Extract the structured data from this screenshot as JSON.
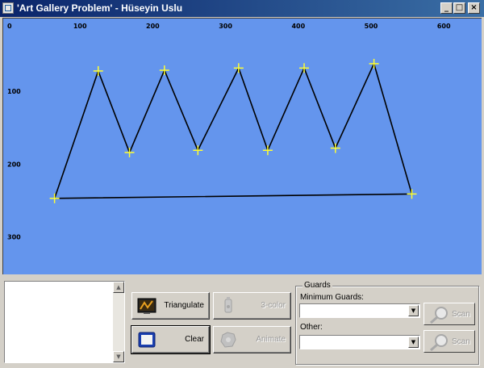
{
  "window": {
    "title": "'Art Gallery Problem' - Hüseyin Uslu",
    "controls": {
      "minimize": "_",
      "maximize": "□",
      "close": "×"
    }
  },
  "canvas": {
    "background": "#6495ed",
    "x_ticks": [
      "0",
      "100",
      "200",
      "300",
      "400",
      "500",
      "600"
    ],
    "y_ticks": [
      "100",
      "200",
      "300"
    ],
    "polygon_color": "#000000",
    "vertex_marker_color": "#ffff33",
    "vertices": [
      {
        "x": 65,
        "y": 247
      },
      {
        "x": 125,
        "y": 72
      },
      {
        "x": 168,
        "y": 184
      },
      {
        "x": 216,
        "y": 71
      },
      {
        "x": 262,
        "y": 181
      },
      {
        "x": 318,
        "y": 68
      },
      {
        "x": 358,
        "y": 181
      },
      {
        "x": 408,
        "y": 68
      },
      {
        "x": 451,
        "y": 178
      },
      {
        "x": 504,
        "y": 62
      },
      {
        "x": 556,
        "y": 241
      }
    ]
  },
  "buttons": {
    "triangulate": "Triangulate",
    "three_color": "3-color",
    "clear": "Clear",
    "animate": "Animate"
  },
  "guards": {
    "legend": "Guards",
    "minimum_label": "Minimum Guards:",
    "minimum_value": "",
    "other_label": "Other:",
    "other_value": "",
    "scan_label": "Scan"
  }
}
